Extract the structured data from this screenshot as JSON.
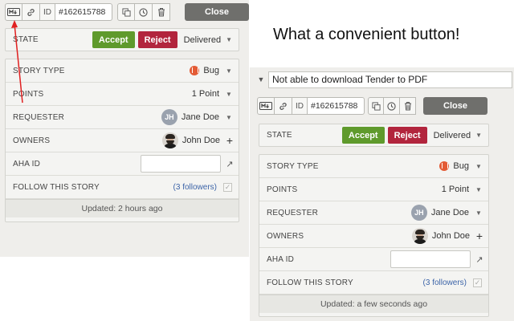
{
  "caption": "What a convenient button!",
  "left": {
    "toolbar": {
      "id_label": "ID",
      "id_value": "#162615788",
      "close_label": "Close"
    },
    "state": {
      "label": "STATE",
      "accept": "Accept",
      "reject": "Reject",
      "value": "Delivered"
    },
    "rows": {
      "story_type": {
        "label": "STORY TYPE",
        "value": "Bug"
      },
      "points": {
        "label": "POINTS",
        "value": "1 Point"
      },
      "requester": {
        "label": "REQUESTER",
        "initials": "JH",
        "value": "Jane Doe"
      },
      "owners": {
        "label": "OWNERS",
        "value": "John Doe"
      },
      "aha": {
        "label": "AHA ID",
        "value": ""
      },
      "follow": {
        "label": "FOLLOW THIS STORY",
        "followers": "(3 followers)"
      }
    },
    "updated": "Updated: 2 hours ago"
  },
  "right": {
    "story_title": "Not able to download Tender to PDF",
    "toolbar": {
      "id_label": "ID",
      "id_value": "#162615788",
      "close_label": "Close"
    },
    "state": {
      "label": "STATE",
      "accept": "Accept",
      "reject": "Reject",
      "value": "Delivered"
    },
    "rows": {
      "story_type": {
        "label": "STORY TYPE",
        "value": "Bug"
      },
      "points": {
        "label": "POINTS",
        "value": "1 Point"
      },
      "requester": {
        "label": "REQUESTER",
        "initials": "JH",
        "value": "Jane Doe"
      },
      "owners": {
        "label": "OWNERS",
        "value": "John Doe"
      },
      "aha": {
        "label": "AHA ID",
        "value": ""
      },
      "follow": {
        "label": "FOLLOW THIS STORY",
        "followers": "(3 followers)"
      }
    },
    "updated": "Updated: a few seconds ago"
  },
  "icons": {
    "markdown": "markdown-icon",
    "link": "link-icon",
    "clone": "clone-icon",
    "history": "clock-icon",
    "delete": "trash-icon",
    "caret": "caret-down-icon",
    "add": "plus-icon",
    "external": "external-link-icon",
    "check": "checkbox-icon",
    "bug": "bug-icon"
  },
  "colors": {
    "accept": "#5f9a2c",
    "reject": "#b2253d",
    "close": "#6f6f6c",
    "annotation_arrow": "#e02020"
  }
}
